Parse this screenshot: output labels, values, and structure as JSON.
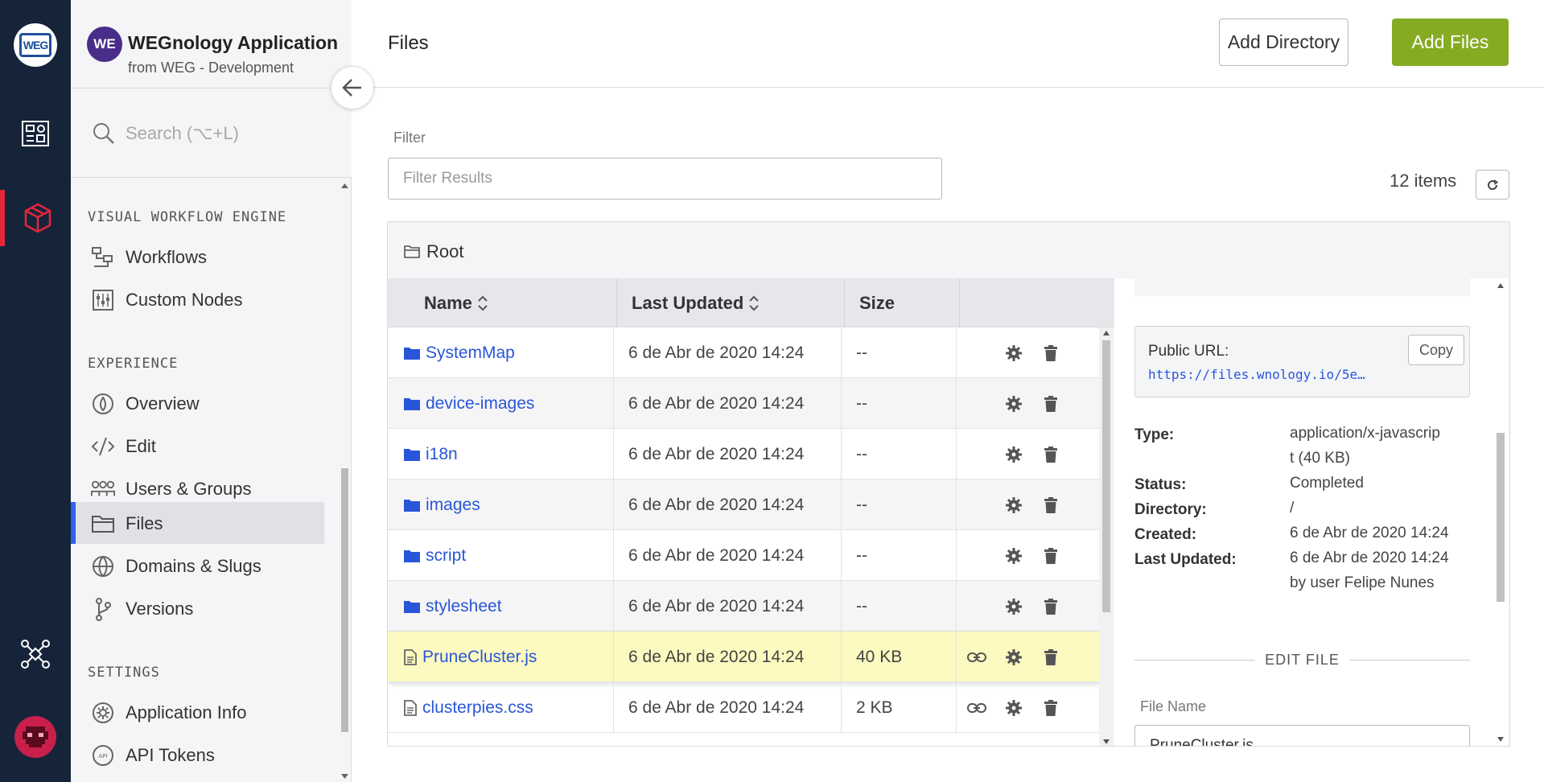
{
  "rail": {
    "logo_text": "WEG",
    "items": [
      "dashboards-icon",
      "applications-icon",
      "devices-icon"
    ],
    "accent": "#e4263d"
  },
  "app": {
    "avatar": "WE",
    "name": "WEGnology Application",
    "subtitle": "from WEG - Development"
  },
  "search": {
    "placeholder": "Search (⌥+L)"
  },
  "nav": {
    "sections": [
      {
        "label": "VISUAL WORKFLOW ENGINE"
      },
      {
        "label": "EXPERIENCE"
      },
      {
        "label": "SETTINGS"
      }
    ],
    "items": [
      {
        "label": "Workflows",
        "icon": "workflow-icon"
      },
      {
        "label": "Custom Nodes",
        "icon": "custom-nodes-icon"
      },
      {
        "label": "Overview",
        "icon": "overview-icon"
      },
      {
        "label": "Edit",
        "icon": "edit-icon"
      },
      {
        "label": "Users & Groups",
        "icon": "users-icon"
      },
      {
        "label": "Files",
        "icon": "folder-icon",
        "active": true
      },
      {
        "label": "Domains & Slugs",
        "icon": "globe-icon"
      },
      {
        "label": "Versions",
        "icon": "branch-icon"
      },
      {
        "label": "Application Info",
        "icon": "gear-icon"
      },
      {
        "label": "API Tokens",
        "icon": "api-token-icon"
      }
    ]
  },
  "header": {
    "title": "Files",
    "add_directory": "Add Directory",
    "add_files": "Add Files",
    "accent": "#84ab22"
  },
  "filter": {
    "label": "Filter",
    "placeholder": "Filter Results",
    "value": ""
  },
  "items_count": "12 items",
  "breadcrumb": {
    "root": "Root"
  },
  "table": {
    "columns": [
      "Name",
      "Last Updated",
      "Size"
    ],
    "rows": [
      {
        "name": "SystemMap",
        "type": "folder",
        "updated": "6 de Abr de 2020 14:24",
        "size": "--"
      },
      {
        "name": "device-images",
        "type": "folder",
        "updated": "6 de Abr de 2020 14:24",
        "size": "--"
      },
      {
        "name": "i18n",
        "type": "folder",
        "updated": "6 de Abr de 2020 14:24",
        "size": "--"
      },
      {
        "name": "images",
        "type": "folder",
        "updated": "6 de Abr de 2020 14:24",
        "size": "--"
      },
      {
        "name": "script",
        "type": "folder",
        "updated": "6 de Abr de 2020 14:24",
        "size": "--"
      },
      {
        "name": "stylesheet",
        "type": "folder",
        "updated": "6 de Abr de 2020 14:24",
        "size": "--"
      },
      {
        "name": "PruneCluster.js",
        "type": "file",
        "updated": "6 de Abr de 2020 14:24",
        "size": "40 KB",
        "selected": true
      },
      {
        "name": "clusterpies.css",
        "type": "file",
        "updated": "6 de Abr de 2020 14:24",
        "size": "2 KB"
      }
    ]
  },
  "details": {
    "public_url_label": "Public URL:",
    "public_url": "https://files.wnology.io/5e…",
    "copy": "Copy",
    "type_label": "Type:",
    "type_line1": "application/x-javascrip",
    "type_line2": "t (40 KB)",
    "status_label": "Status:",
    "status": "Completed",
    "directory_label": "Directory:",
    "directory": "/",
    "created_label": "Created:",
    "created": "6 de Abr de 2020 14:24",
    "updated_label": "Last Updated:",
    "updated_line1": "6 de Abr de 2020 14:24",
    "updated_line2": "by user Felipe Nunes",
    "edit_title": "EDIT FILE",
    "file_name_label": "File Name",
    "file_name_value": "PruneCluster.js"
  }
}
